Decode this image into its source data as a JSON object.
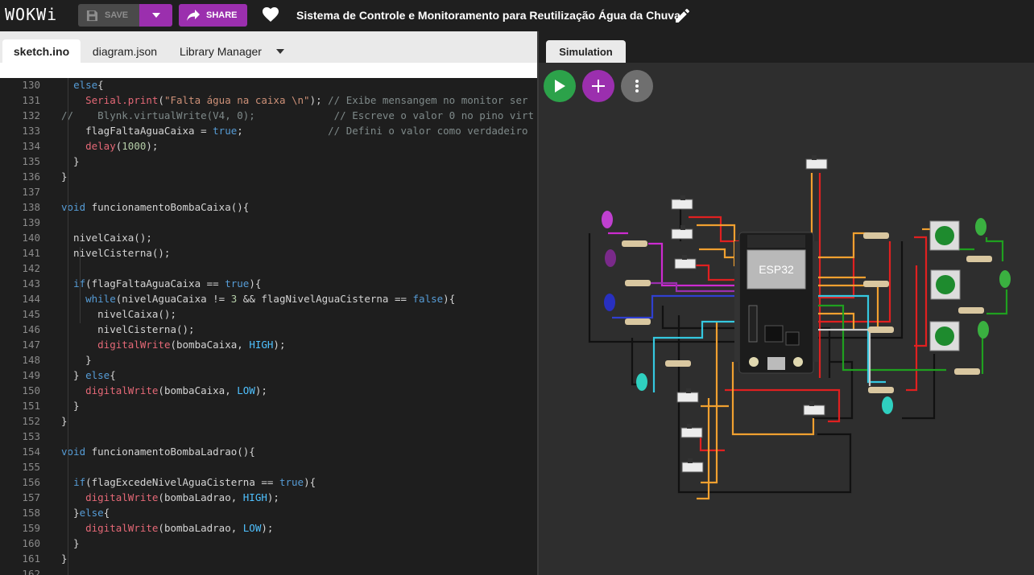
{
  "header": {
    "logo": "WOKWi",
    "save_label": "SAVE",
    "share_label": "SHARE",
    "project_title": "Sistema de Controle e Monitoramento para Reutilização Água da Chuva"
  },
  "editor": {
    "tabs": [
      {
        "label": "sketch.ino",
        "active": true
      },
      {
        "label": "diagram.json",
        "active": false
      },
      {
        "label": "Library Manager",
        "active": false
      }
    ],
    "lines": [
      {
        "n": "130",
        "code": "  else{"
      },
      {
        "n": "131",
        "code": "    Serial.print(\"Falta água na caixa \\n\"); // Exibe mensangem no monitor ser"
      },
      {
        "n": "132",
        "code": "//    Blynk.virtualWrite(V4, 0);             // Escreve o valor 0 no pino virt"
      },
      {
        "n": "133",
        "code": "    flagFaltaAguaCaixa = true;              // Defini o valor como verdadeiro"
      },
      {
        "n": "134",
        "code": "    delay(1000);"
      },
      {
        "n": "135",
        "code": "  }"
      },
      {
        "n": "136",
        "code": "}"
      },
      {
        "n": "137",
        "code": ""
      },
      {
        "n": "138",
        "code": "void funcionamentoBombaCaixa(){"
      },
      {
        "n": "139",
        "code": ""
      },
      {
        "n": "140",
        "code": "  nivelCaixa();"
      },
      {
        "n": "141",
        "code": "  nivelCisterna();"
      },
      {
        "n": "142",
        "code": ""
      },
      {
        "n": "143",
        "code": "  if(flagFaltaAguaCaixa == true){"
      },
      {
        "n": "144",
        "code": "    while(nivelAguaCaixa != 3 && flagNivelAguaCisterna == false){"
      },
      {
        "n": "145",
        "code": "      nivelCaixa();"
      },
      {
        "n": "146",
        "code": "      nivelCisterna();"
      },
      {
        "n": "147",
        "code": "      digitalWrite(bombaCaixa, HIGH);"
      },
      {
        "n": "148",
        "code": "    }"
      },
      {
        "n": "149",
        "code": "  } else{"
      },
      {
        "n": "150",
        "code": "    digitalWrite(bombaCaixa, LOW);"
      },
      {
        "n": "151",
        "code": "  }"
      },
      {
        "n": "152",
        "code": "}"
      },
      {
        "n": "153",
        "code": ""
      },
      {
        "n": "154",
        "code": "void funcionamentoBombaLadrao(){"
      },
      {
        "n": "155",
        "code": ""
      },
      {
        "n": "156",
        "code": "  if(flagExcedeNivelAguaCisterna == true){"
      },
      {
        "n": "157",
        "code": "    digitalWrite(bombaLadrao, HIGH);"
      },
      {
        "n": "158",
        "code": "  }else{"
      },
      {
        "n": "159",
        "code": "    digitalWrite(bombaLadrao, LOW);"
      },
      {
        "n": "160",
        "code": "  }"
      },
      {
        "n": "161",
        "code": "}"
      },
      {
        "n": "162",
        "code": ""
      }
    ]
  },
  "simulation": {
    "tab_label": "Simulation",
    "board_label": "ESP32"
  },
  "colors": {
    "accent_purple": "#9b2fae",
    "play_green": "#2ca24a"
  }
}
